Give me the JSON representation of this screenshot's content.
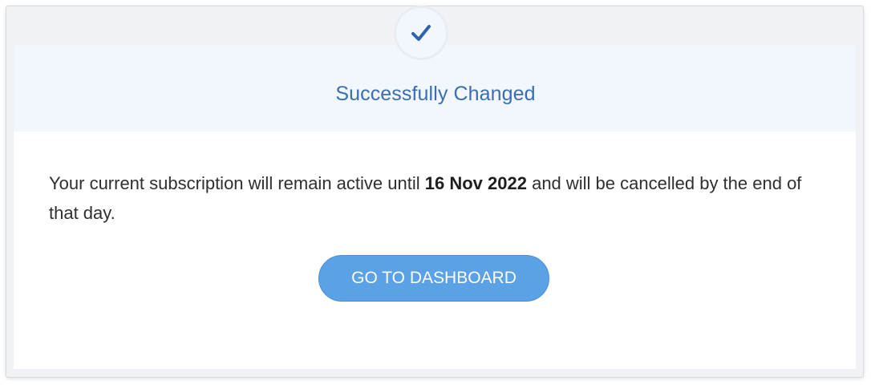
{
  "dialog": {
    "status_icon": "checkmark-icon",
    "title": "Successfully Changed",
    "message_before": "Your current subscription will remain active until",
    "end_date": "16 Nov 2022",
    "message_after": "and will be cancelled by the end of that day.",
    "button_label": "GO TO DASHBOARD"
  },
  "colors": {
    "accent": "#3a6eb4",
    "button": "#5ba1e6",
    "header_background": "#f1f7fd"
  }
}
